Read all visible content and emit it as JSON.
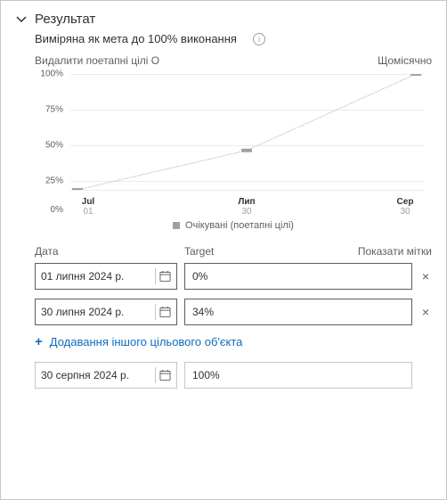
{
  "header": {
    "title": "Результат",
    "subtitle": "Виміряна як мета до 100% виконання"
  },
  "links": {
    "remove_milestones": "Видалити поетапні цілі",
    "remove_icon": "О",
    "frequency": "Щомісячно"
  },
  "chart_data": {
    "type": "line",
    "title": "",
    "xlabel": "",
    "ylabel": "",
    "ylim": [
      0,
      100
    ],
    "y_ticks": [
      "0%",
      "25%",
      "50%",
      "75%",
      "100%"
    ],
    "categories": [
      "Jul 01",
      "Лип 30",
      "Сер 30"
    ],
    "x_labels": [
      {
        "month": "Jul",
        "day": "01"
      },
      {
        "month": "Лип",
        "day": "30"
      },
      {
        "month": "Сер",
        "day": "30"
      }
    ],
    "series": [
      {
        "name": "Очікувані (поетапні цілі)",
        "values": [
          0,
          34,
          100
        ]
      }
    ],
    "legend_label": "Очікувані (поетапні цілі)"
  },
  "columns": {
    "date": "Дата",
    "target": "Target",
    "show_labels": "Показати мітки"
  },
  "rows": [
    {
      "date": "01 липня 2024 р.",
      "target": "0%"
    },
    {
      "date": "30 липня 2024 р.",
      "target": "34%"
    }
  ],
  "add_label": "Додавання іншого цільового об'єкта",
  "final": {
    "date": "30 серпня 2024 р.",
    "target": "100%"
  },
  "icons": {
    "remove": "×",
    "info": "i",
    "plus": "+"
  }
}
